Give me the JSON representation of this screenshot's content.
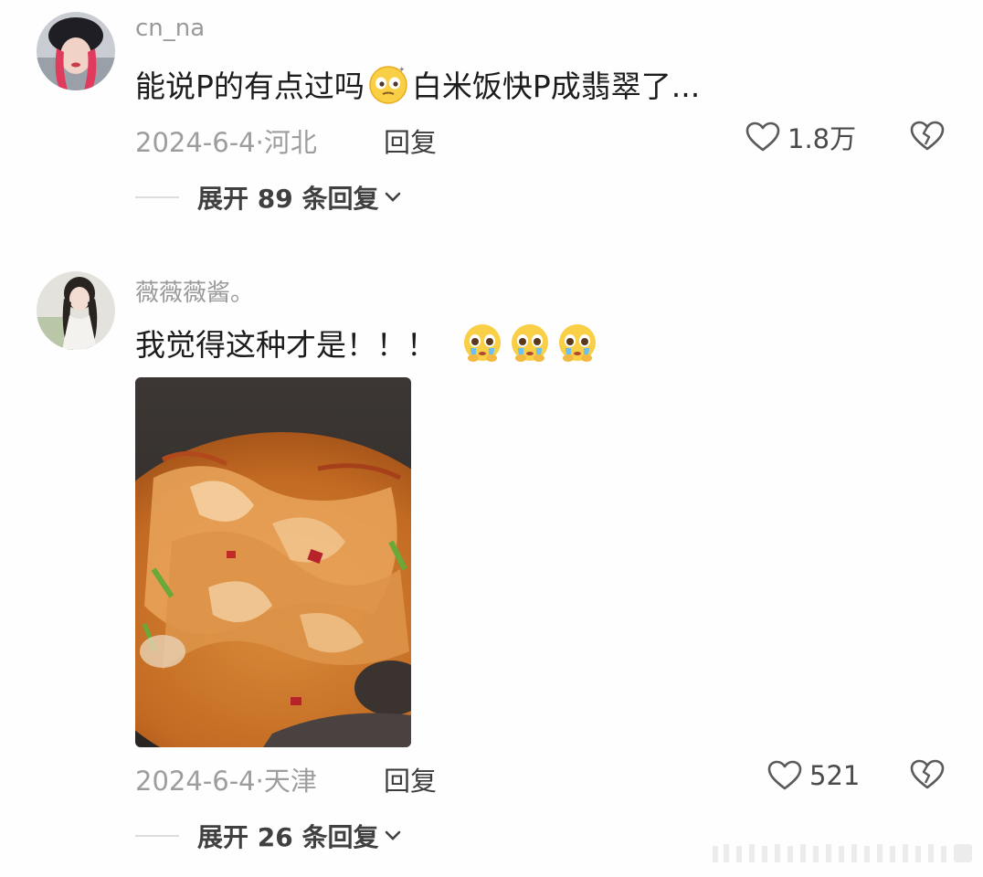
{
  "comments": [
    {
      "username": "cn_na",
      "text_part1": "能说P的有点过吗",
      "text_part2": "白米饭快P成翡翠了...",
      "emoji": "dizzy-face-emoji",
      "date": "2024-6-4·",
      "location": "河北",
      "reply_label": "回复",
      "likes": "1.8万",
      "expand_label": "展开 89 条回复"
    },
    {
      "username": "薇薇薇酱。",
      "text": "我觉得这种才是！！！",
      "emoji": "pleading-crying-face-emoji",
      "emoji_count": 3,
      "date": "2024-6-4·",
      "location": "天津",
      "reply_label": "回复",
      "likes": "521",
      "expand_label": "展开 26 条回复"
    }
  ],
  "colors": {
    "background": "#fefefe",
    "username": "#9a9a9a",
    "meta": "#9d9d9d",
    "text": "#1c1c1c"
  }
}
